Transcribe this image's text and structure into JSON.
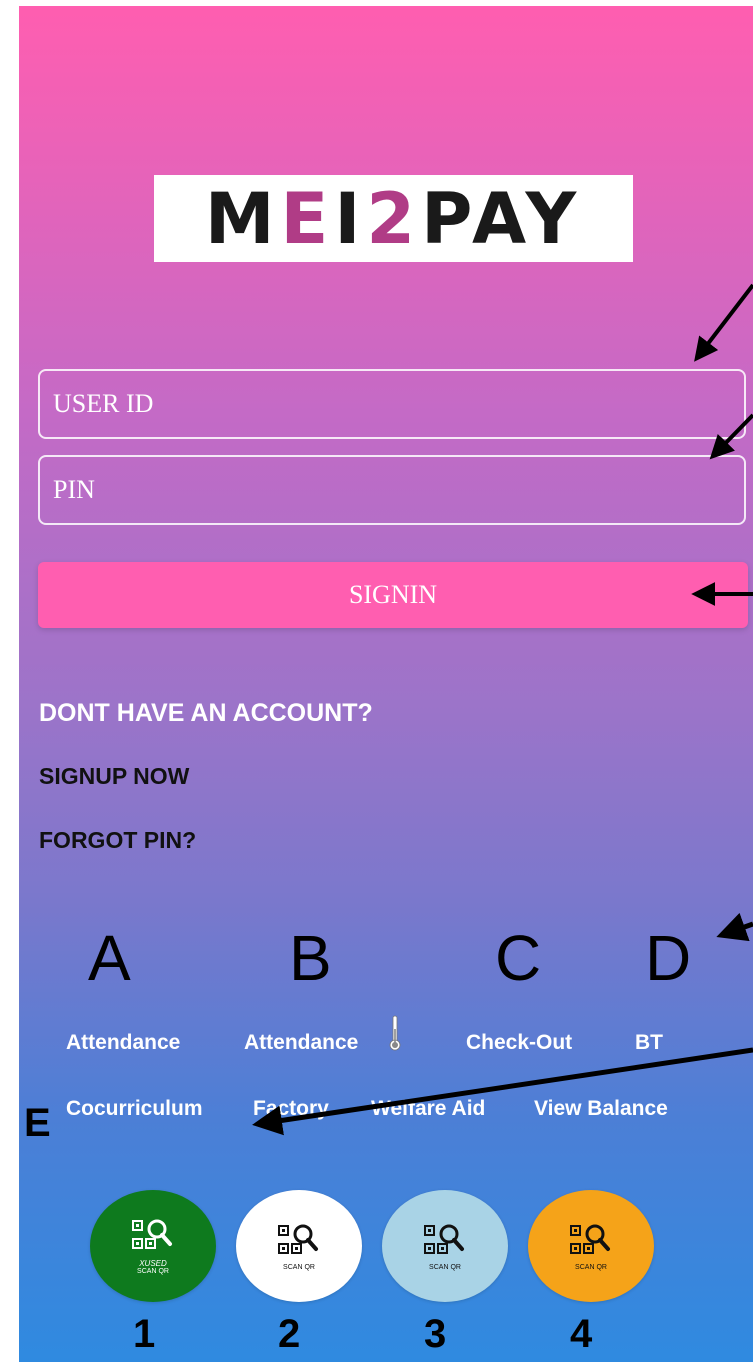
{
  "logo": {
    "text_dark_1": "M",
    "text_accent_1": "E",
    "text_dark_2": "I",
    "text_accent_2": "2",
    "text_dark_3": "PAY"
  },
  "login": {
    "user_id_placeholder": "USER ID",
    "pin_placeholder": "PIN",
    "signin_label": "SIGNIN"
  },
  "account": {
    "dont_have": "DONT HAVE AN ACCOUNT?",
    "signup": "SIGNUP NOW",
    "forgot": "FORGOT PIN?"
  },
  "annotations": {
    "letters": [
      "A",
      "B",
      "C",
      "D",
      "E"
    ],
    "numbers": [
      "1",
      "2",
      "3",
      "4"
    ]
  },
  "menu": {
    "row1": [
      "Attendance",
      "Attendance",
      "Check-Out",
      "BT"
    ],
    "row2": [
      "Cocurriculum",
      "Factory",
      "Welfare Aid",
      "View Balance"
    ]
  },
  "qr_buttons": [
    {
      "caption_top": "XUSED",
      "caption": "SCAN QR",
      "color": "#0e7a1e",
      "text_color": "#ffffff"
    },
    {
      "caption": "SCAN QR",
      "color": "#ffffff",
      "text_color": "#111111"
    },
    {
      "caption": "SCAN QR",
      "color": "#a9d3e6",
      "text_color": "#111111"
    },
    {
      "caption": "SCAN QR",
      "color": "#f5a319",
      "text_color": "#111111"
    }
  ],
  "colors": {
    "accent_pink": "#ff5eb0",
    "logo_accent": "#b03c86"
  }
}
